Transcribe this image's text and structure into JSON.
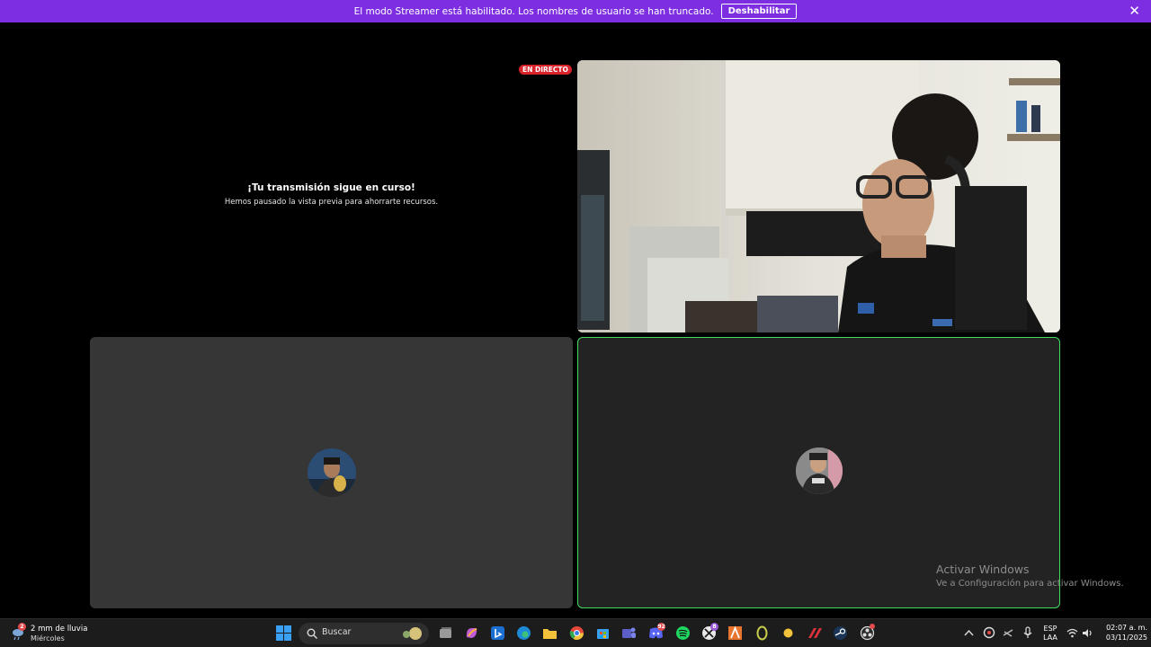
{
  "banner": {
    "message": "El modo Streamer está habilitado. Los nombres de usuario se han truncado.",
    "button_label": "Deshabilitar",
    "close_glyph": "✕",
    "color": "#7c2ee0"
  },
  "stream": {
    "live_badge": "EN DIRECTO",
    "title": "¡Tu transmisión sigue en curso!",
    "subtitle": "Hemos pausado la vista previa para ahorrarte recursos."
  },
  "participants": [
    {
      "icon": "user-avatar-icon",
      "speaking": false
    },
    {
      "icon": "user-avatar-icon",
      "speaking": true,
      "ring_color": "#3fdc5f"
    }
  ],
  "watermark": {
    "title": "Activar Windows",
    "subtitle": "Ve a Configuración para activar Windows."
  },
  "taskbar": {
    "weather": {
      "badge": "2",
      "line1": "2 mm de lluvia",
      "line2": "Miércoles"
    },
    "search_placeholder": "Buscar",
    "apps": [
      {
        "name": "start",
        "icon": "windows-logo-icon"
      },
      {
        "name": "task-view",
        "icon": "task-view-icon"
      },
      {
        "name": "copilot",
        "icon": "copilot-icon"
      },
      {
        "name": "bing",
        "icon": "bing-icon"
      },
      {
        "name": "edge",
        "icon": "edge-icon"
      },
      {
        "name": "explorer",
        "icon": "folder-icon"
      },
      {
        "name": "chrome",
        "icon": "chrome-icon"
      },
      {
        "name": "store",
        "icon": "store-icon"
      },
      {
        "name": "teams",
        "icon": "teams-icon"
      },
      {
        "name": "discord",
        "icon": "discord-icon",
        "badge": "92"
      },
      {
        "name": "spotify",
        "icon": "spotify-icon"
      },
      {
        "name": "xbox",
        "icon": "xbox-icon",
        "badge": "8"
      },
      {
        "name": "office",
        "icon": "office-icon"
      },
      {
        "name": "app-ring",
        "icon": "ring-app-icon"
      },
      {
        "name": "app-dot",
        "icon": "yellow-dot-icon"
      },
      {
        "name": "epic",
        "icon": "game-launcher-icon"
      },
      {
        "name": "steam",
        "icon": "steam-icon"
      },
      {
        "name": "obs",
        "icon": "obs-icon"
      }
    ],
    "tray": {
      "lang1": "ESP",
      "lang2": "LAA",
      "time": "02:07 a. m.",
      "date": "03/11/2025"
    }
  }
}
